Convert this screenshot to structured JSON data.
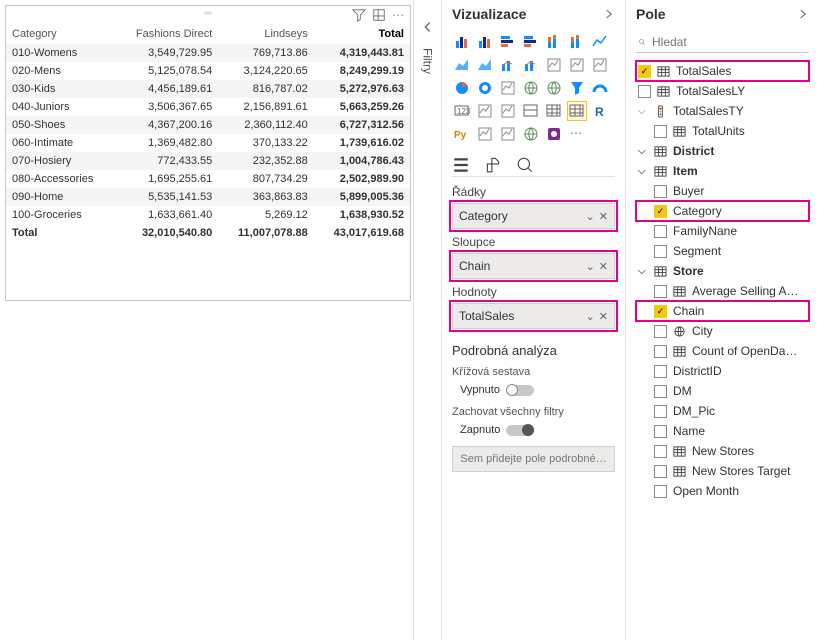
{
  "matrix": {
    "columns": [
      "Category",
      "Fashions Direct",
      "Lindseys",
      "Total"
    ],
    "rows": [
      {
        "cat": "010-Womens",
        "v1": "3,549,729.95",
        "v2": "769,713.86",
        "t": "4,319,443.81"
      },
      {
        "cat": "020-Mens",
        "v1": "5,125,078.54",
        "v2": "3,124,220.65",
        "t": "8,249,299.19"
      },
      {
        "cat": "030-Kids",
        "v1": "4,456,189.61",
        "v2": "816,787.02",
        "t": "5,272,976.63"
      },
      {
        "cat": "040-Juniors",
        "v1": "3,506,367.65",
        "v2": "2,156,891.61",
        "t": "5,663,259.26"
      },
      {
        "cat": "050-Shoes",
        "v1": "4,367,200.16",
        "v2": "2,360,112.40",
        "t": "6,727,312.56"
      },
      {
        "cat": "060-Intimate",
        "v1": "1,369,482.80",
        "v2": "370,133.22",
        "t": "1,739,616.02"
      },
      {
        "cat": "070-Hosiery",
        "v1": "772,433.55",
        "v2": "232,352.88",
        "t": "1,004,786.43"
      },
      {
        "cat": "080-Accessories",
        "v1": "1,695,255.61",
        "v2": "807,734.29",
        "t": "2,502,989.90"
      },
      {
        "cat": "090-Home",
        "v1": "5,535,141.53",
        "v2": "363,863.83",
        "t": "5,899,005.36"
      },
      {
        "cat": "100-Groceries",
        "v1": "1,633,661.40",
        "v2": "5,269.12",
        "t": "1,638,930.52"
      }
    ],
    "totalRow": {
      "cat": "Total",
      "v1": "32,010,540.80",
      "v2": "11,007,078.88",
      "t": "43,017,619.68"
    }
  },
  "filters": {
    "label": "Filtry"
  },
  "viz": {
    "title": "Vizualizace",
    "toolSections": {
      "rows": "Řádky",
      "cols": "Sloupce",
      "vals": "Hodnoty"
    },
    "wells": {
      "rows": "Category",
      "cols": "Chain",
      "vals": "TotalSales"
    },
    "drill": {
      "title": "Podrobná analýza",
      "cross": "Křížová sestava",
      "off": "Vypnuto",
      "keep": "Zachovat všechny filtry",
      "on": "Zapnuto",
      "placeholder": "Sem přidejte pole podrobné…"
    }
  },
  "fields": {
    "title": "Pole",
    "searchPlaceholder": "Hledat",
    "items": [
      {
        "type": "field",
        "name": "TotalSales",
        "checked": true,
        "highlight": true,
        "icon": "table"
      },
      {
        "type": "field",
        "name": "TotalSalesLY",
        "checked": false,
        "icon": "table"
      },
      {
        "type": "sub",
        "name": "TotalSalesTY",
        "icon": "traffic"
      },
      {
        "type": "field",
        "name": "TotalUnits",
        "checked": false,
        "icon": "table",
        "indent": true
      },
      {
        "type": "table",
        "name": "District",
        "icon": "table"
      },
      {
        "type": "table",
        "name": "Item",
        "icon": "table-y"
      },
      {
        "type": "field",
        "name": "Buyer",
        "checked": false,
        "indent": true
      },
      {
        "type": "field",
        "name": "Category",
        "checked": true,
        "highlight": true,
        "indent": true
      },
      {
        "type": "field",
        "name": "FamilyNane",
        "checked": false,
        "indent": true
      },
      {
        "type": "field",
        "name": "Segment",
        "checked": false,
        "indent": true
      },
      {
        "type": "table",
        "name": "Store",
        "icon": "table-y"
      },
      {
        "type": "field",
        "name": "Average Selling A…",
        "checked": false,
        "icon": "table",
        "indent": true
      },
      {
        "type": "field",
        "name": "Chain",
        "checked": true,
        "highlight": true,
        "indent": true
      },
      {
        "type": "field",
        "name": "City",
        "checked": false,
        "icon": "globe",
        "indent": true
      },
      {
        "type": "field",
        "name": "Count of OpenDa…",
        "checked": false,
        "icon": "table",
        "indent": true
      },
      {
        "type": "field",
        "name": "DistrictID",
        "checked": false,
        "indent": true
      },
      {
        "type": "field",
        "name": "DM",
        "checked": false,
        "indent": true
      },
      {
        "type": "field",
        "name": "DM_Pic",
        "checked": false,
        "indent": true
      },
      {
        "type": "field",
        "name": "Name",
        "checked": false,
        "indent": true
      },
      {
        "type": "field",
        "name": "New Stores",
        "checked": false,
        "icon": "table",
        "indent": true
      },
      {
        "type": "field",
        "name": "New Stores Target",
        "checked": false,
        "icon": "table",
        "indent": true
      },
      {
        "type": "field",
        "name": "Open Month",
        "checked": false,
        "indent": true
      }
    ]
  }
}
